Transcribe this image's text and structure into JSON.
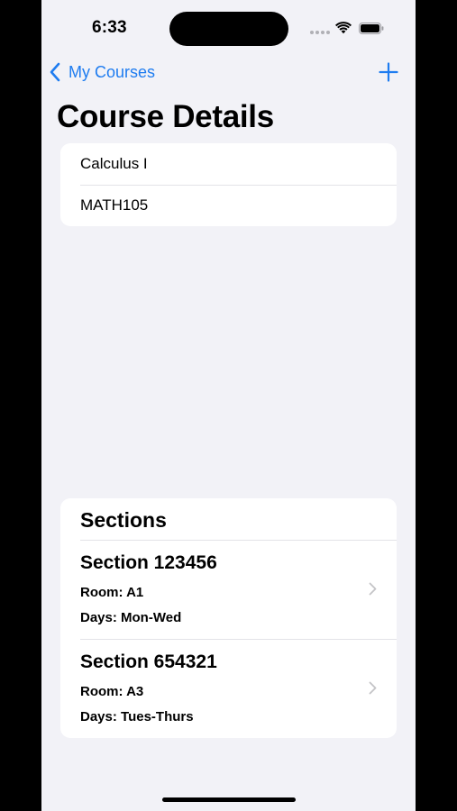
{
  "status_bar": {
    "time": "6:33"
  },
  "nav": {
    "back_label": "My Courses",
    "back_icon": "chevron-left-icon",
    "add_icon": "plus-icon"
  },
  "page": {
    "title": "Course Details"
  },
  "course": {
    "name": "Calculus I",
    "code": "MATH105"
  },
  "sections": {
    "header": "Sections",
    "items": [
      {
        "title": "Section 123456",
        "room": "Room: A1",
        "days": "Days: Mon-Wed"
      },
      {
        "title": "Section 654321",
        "room": "Room: A3",
        "days": "Days: Tues-Thurs"
      }
    ]
  },
  "colors": {
    "accent": "#1E7CF0",
    "background": "#F2F2F7",
    "card": "#FFFFFF",
    "chevron": "#C4C4C7"
  }
}
